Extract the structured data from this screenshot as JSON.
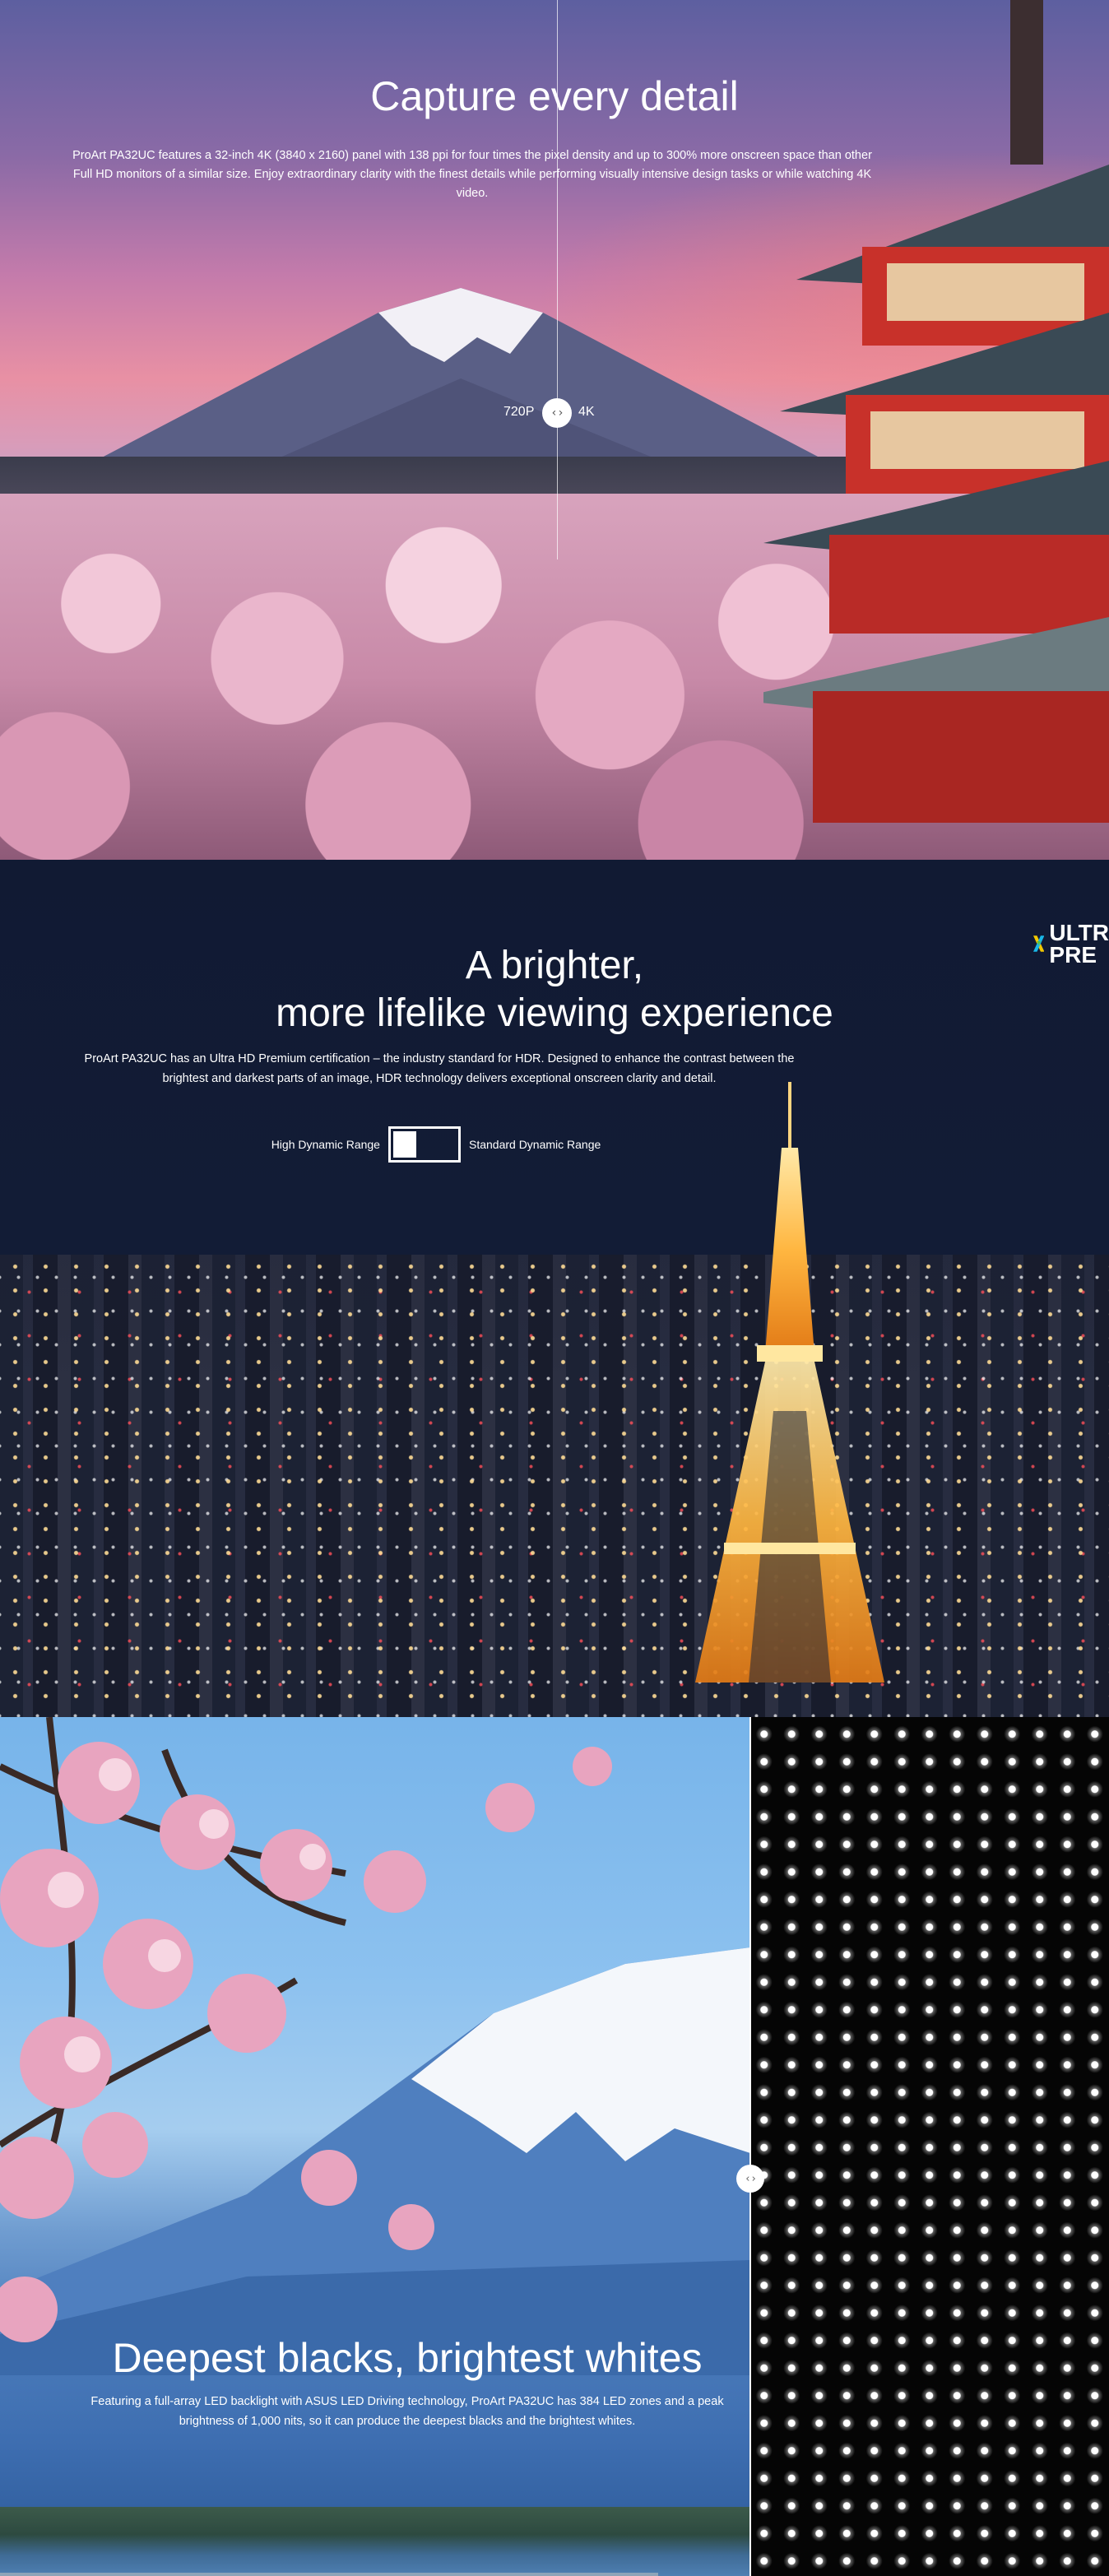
{
  "section_detail": {
    "title": "Capture every detail",
    "description": "ProArt PA32UC features a 32-inch 4K (3840 x 2160) panel with 138 ppi for four times the pixel density and up to 300% more onscreen space than other Full HD monitors of a similar size. Enjoy extraordinary clarity with the finest details while performing visually intensive design tasks or while watching 4K video.",
    "compare_left_label": "720P",
    "compare_right_label": "4K",
    "handle_glyph": "‹ ›"
  },
  "section_hdr": {
    "title_line1": "A brighter,",
    "title_line2": "more lifelike viewing experience",
    "description": "ProArt PA32UC has an Ultra HD Premium certification – the industry standard for HDR. Designed to enhance the contrast between the brightest and darkest parts of an image, HDR technology delivers exceptional onscreen clarity and detail.",
    "toggle_left_label": "High Dynamic Range",
    "toggle_right_label": "Standard Dynamic Range",
    "logo_line1": "ULTR",
    "logo_line2": "PRE"
  },
  "section_blacks": {
    "title": "Deepest blacks, brightest whites",
    "description": "Featuring a full-array LED backlight with ASUS LED Driving technology, ProArt PA32UC has 384 LED zones and a peak brightness of 1,000 nits, so it can produce the deepest blacks and the brightest whites.",
    "handle_glyph": "‹ ›"
  }
}
